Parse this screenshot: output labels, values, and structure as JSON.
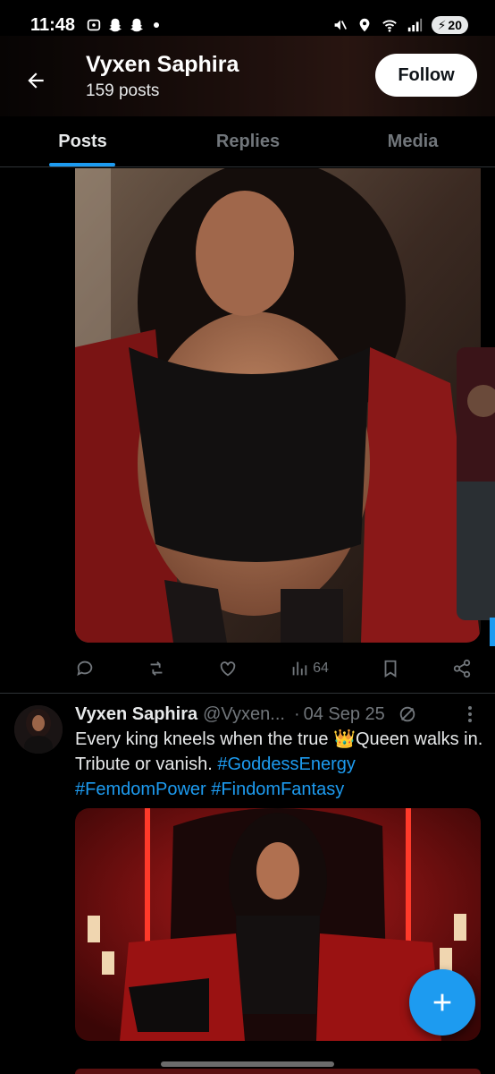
{
  "status_bar": {
    "time": "11:48",
    "battery": "20",
    "icons": [
      "screenshot-icon",
      "snapchat-icon",
      "snapchat-icon",
      "mute-icon",
      "location-icon",
      "wifi-icon",
      "signal-icon"
    ]
  },
  "header": {
    "name": "Vyxen Saphira",
    "posts": "159 posts",
    "follow_label": "Follow"
  },
  "tabs": [
    {
      "label": "Posts",
      "active": true
    },
    {
      "label": "Replies",
      "active": false
    },
    {
      "label": "Media",
      "active": false
    }
  ],
  "post1": {
    "views": "64"
  },
  "post2": {
    "author": "Vyxen Saphira",
    "handle": "@Vyxen...",
    "separator": "·",
    "date": "04 Sep 25",
    "text_before": "Every king kneels when the true ",
    "emoji": "👑",
    "text_after": "Queen walks in. Tribute or vanish. ",
    "hashtags": [
      "#GoddessEnergy",
      "#FemdomPower",
      "#FindomFantasy"
    ]
  },
  "colors": {
    "accent": "#1d9bf0",
    "background": "#000000",
    "muted": "#71767b"
  }
}
